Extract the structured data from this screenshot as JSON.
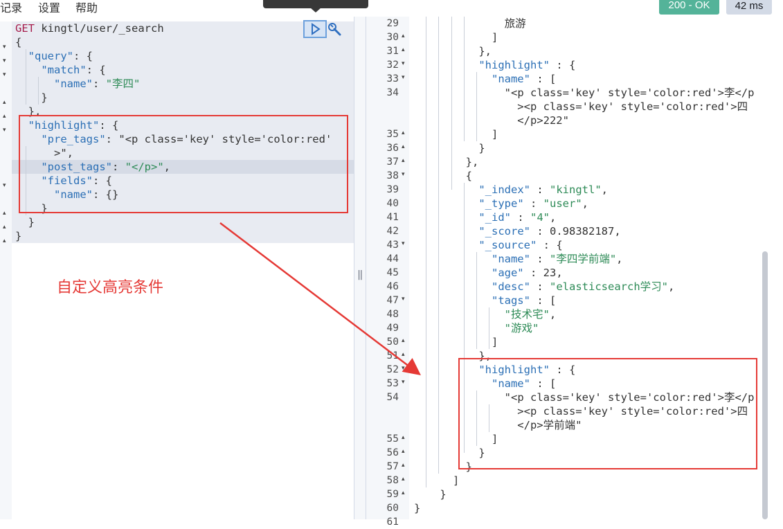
{
  "menu": {
    "item1": "记录",
    "item2": "设置",
    "item3": "帮助"
  },
  "status": {
    "code": "200 - OK",
    "time": "42 ms"
  },
  "request": {
    "method": "GET",
    "path": "kingtl/user/_search",
    "lines": [
      "{",
      "  \"query\": {",
      "    \"match\": {",
      "      \"name\": \"李四\"",
      "    }",
      "  },",
      "  \"highlight\": {",
      "    \"pre_tags\": \"<p class='key' style='color:red'",
      "      >\",",
      "    \"post_tags\": \"</p>\",",
      "    \"fields\": {",
      "      \"name\": {}",
      "    }",
      "  }",
      "}"
    ]
  },
  "annotation": "自定义高亮条件",
  "response": {
    "line_numbers": [
      "29",
      "30",
      "31",
      "32",
      "33",
      "34",
      "",
      "",
      "35",
      "36",
      "37",
      "38",
      "39",
      "40",
      "41",
      "42",
      "43",
      "44",
      "45",
      "46",
      "47",
      "48",
      "49",
      "50",
      "51",
      "52",
      "53",
      "54",
      "",
      "",
      "55",
      "56",
      "57",
      "58",
      "59",
      "60",
      "61"
    ],
    "lines": [
      "              旅游",
      "            ]",
      "          },",
      "          \"highlight\" : {",
      "            \"name\" : [",
      "              \"<p class='key' style='color:red'>李</p",
      "                ><p class='key' style='color:red'>四",
      "                </p>222\"",
      "            ]",
      "          }",
      "        },",
      "        {",
      "          \"_index\" : \"kingtl\",",
      "          \"_type\" : \"user\",",
      "          \"_id\" : \"4\",",
      "          \"_score\" : 0.98382187,",
      "          \"_source\" : {",
      "            \"name\" : \"李四学前端\",",
      "            \"age\" : 23,",
      "            \"desc\" : \"elasticsearch学习\",",
      "            \"tags\" : [",
      "              \"技术宅\",",
      "              \"游戏\"",
      "            ]",
      "          },",
      "          \"highlight\" : {",
      "            \"name\" : [",
      "              \"<p class='key' style='color:red'>李</p",
      "                ><p class='key' style='color:red'>四",
      "                </p>学前端\"",
      "            ]",
      "          }",
      "        }",
      "      ]",
      "    }",
      "}",
      ""
    ]
  },
  "colors": {
    "accent": "#54b399",
    "annotation": "#e53935",
    "key": "#2b6fb5",
    "string": "#2e8b57"
  }
}
